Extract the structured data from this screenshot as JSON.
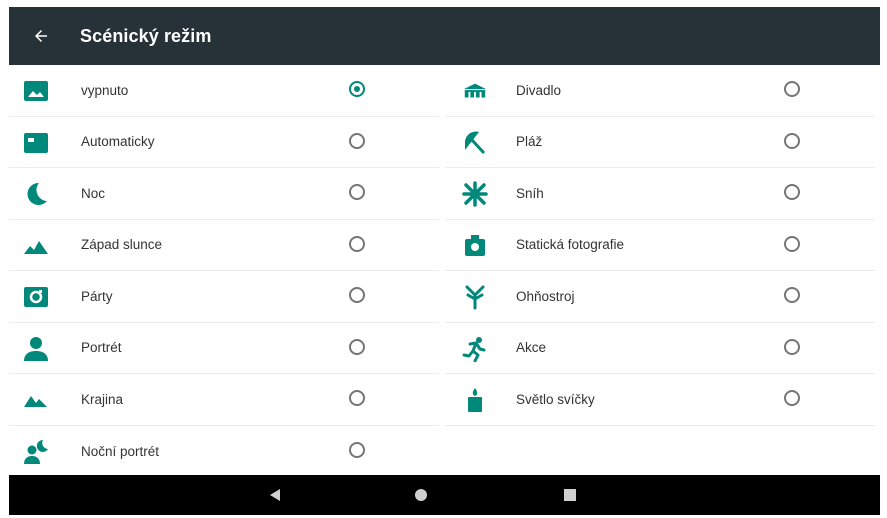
{
  "header": {
    "title": "Scénický režim",
    "back_icon": "arrow-left-icon"
  },
  "colors": {
    "accent": "#00897b",
    "appbar": "#263238",
    "navbar": "#000000"
  },
  "selected": "vypnuto",
  "left_items": [
    {
      "label": "vypnuto",
      "icon": "image-icon",
      "checked": true
    },
    {
      "label": "Automaticky",
      "icon": "auto-icon",
      "checked": false
    },
    {
      "label": "Noc",
      "icon": "moon-icon",
      "checked": false
    },
    {
      "label": "Západ slunce",
      "icon": "sunset-icon",
      "checked": false
    },
    {
      "label": "Párty",
      "icon": "party-icon",
      "checked": false
    },
    {
      "label": "Portrét",
      "icon": "portrait-icon",
      "checked": false
    },
    {
      "label": "Krajina",
      "icon": "landscape-icon",
      "checked": false
    },
    {
      "label": "Noční portrét",
      "icon": "night-portrait-icon",
      "checked": false
    }
  ],
  "right_items": [
    {
      "label": "Divadlo",
      "icon": "theater-icon",
      "checked": false
    },
    {
      "label": "Pláž",
      "icon": "beach-icon",
      "checked": false
    },
    {
      "label": "Sníh",
      "icon": "snow-icon",
      "checked": false
    },
    {
      "label": "Statická fotografie",
      "icon": "still-photo-icon",
      "checked": false
    },
    {
      "label": "Ohňostroj",
      "icon": "fireworks-icon",
      "checked": false
    },
    {
      "label": "Akce",
      "icon": "action-icon",
      "checked": false
    },
    {
      "label": "Světlo svíčky",
      "icon": "candle-icon",
      "checked": false
    }
  ],
  "navigation": {
    "back": "nav-back-icon",
    "home": "nav-home-icon",
    "recents": "nav-recents-icon"
  }
}
